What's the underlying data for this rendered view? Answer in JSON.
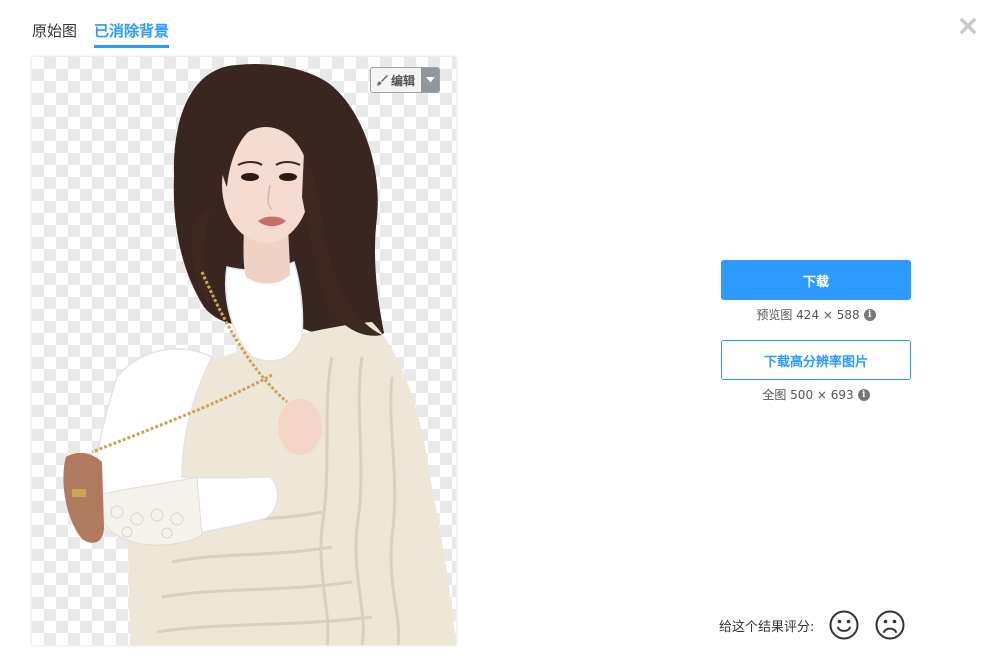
{
  "tabs": [
    {
      "label": "原始图",
      "active": false
    },
    {
      "label": "已消除背景",
      "active": true
    }
  ],
  "preview": {
    "edit_label": "编辑"
  },
  "download": {
    "primary_label": "下载",
    "preview_prefix": "预览图",
    "preview_size": "424 × 588",
    "hd_label": "下载高分辨率图片",
    "full_prefix": "全图",
    "full_size": "500 × 693"
  },
  "rating": {
    "label": "给这个结果评分:"
  },
  "icons": {
    "close": "close-icon",
    "info": "info-icon",
    "brush": "brush-icon",
    "caret": "caret-down-icon",
    "happy": "smile-icon",
    "sad": "frown-icon"
  },
  "colors": {
    "accent": "#2e9aff",
    "checker": "#e9e9e9"
  }
}
